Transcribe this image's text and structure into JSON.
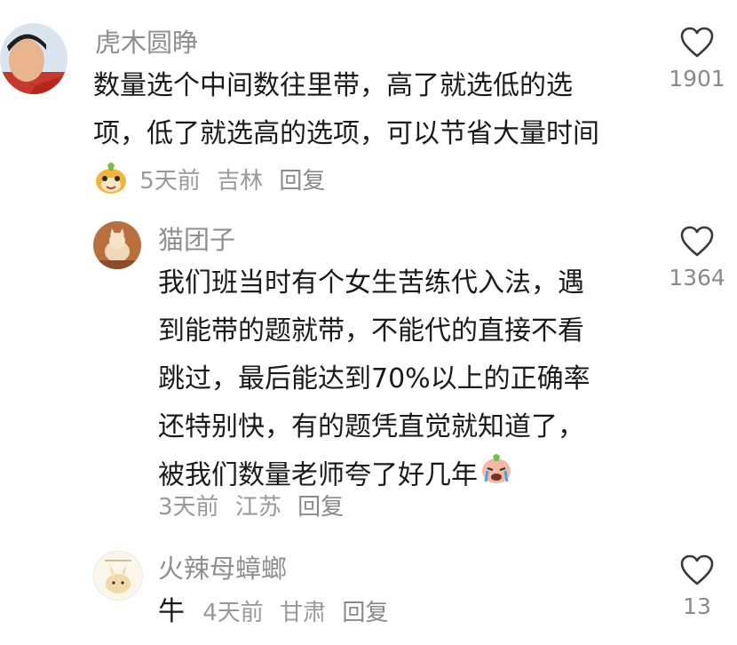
{
  "comments": [
    {
      "username": "虎木圆睁",
      "lines": [
        "数量选个中间数往里带，高了就选低的选",
        "项，低了就选高的选项，可以节省大量时间"
      ],
      "time": "5天前",
      "location": "吉林",
      "reply_label": "回复",
      "likes": "1901"
    },
    {
      "username": "猫团子",
      "lines": [
        "我们班当时有个女生苦练代入法，遇",
        "到能带的题就带，不能代的直接不看",
        "跳过，最后能达到70%以上的正确率",
        "还特别快，有的题凭直觉就知道了，",
        "被我们数量老师夸了好几年"
      ],
      "time": "3天前",
      "location": "江苏",
      "reply_label": "回复",
      "likes": "1364"
    },
    {
      "username": "火辣母蟑螂",
      "text_prefix": "牛",
      "time": "4天前",
      "location": "甘肃",
      "reply_label": "回复",
      "likes": "13"
    }
  ],
  "colors": {
    "username": "#8f8f8f",
    "text": "#1a1a1a",
    "meta": "#999999",
    "heart": "#3a3a3a"
  },
  "icons": {
    "like": "heart-outline-icon",
    "emoji_prefix": "yellow-mascot-emoji-icon",
    "emoji_inline": "crying-face-emoji-icon"
  }
}
